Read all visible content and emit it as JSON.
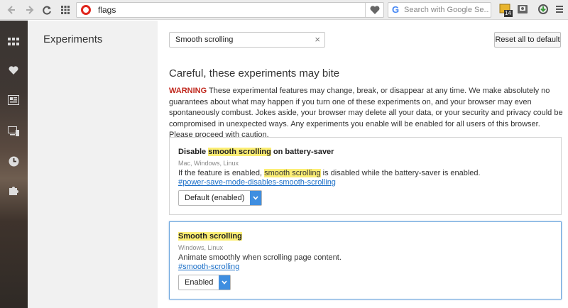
{
  "toolbar": {
    "url": "flags",
    "search_placeholder": "Search with Google Se...",
    "ext_badge": "14"
  },
  "leftnav": {
    "title": "Experiments"
  },
  "main": {
    "filter_value": "Smooth scrolling",
    "clear_glyph": "×",
    "reset_label": "Reset all to default",
    "heading": "Careful, these experiments may bite",
    "warning_label": "WARNING",
    "warning_text": " These experimental features may change, break, or disappear at any time. We make absolutely no guarantees about what may happen if you turn one of these experiments on, and your browser may even spontaneously combust. Jokes aside, your browser may delete all your data, or your security and privacy could be compromised in unexpected ways. Any experiments you enable will be enabled for all users of this browser. Please proceed with caution."
  },
  "experiments": [
    {
      "name_pre": "Disable ",
      "name_hl": "smooth scrolling",
      "name_post": " on battery-saver",
      "platforms": "Mac, Windows, Linux",
      "desc_pre": "If the feature is enabled, ",
      "desc_hl": "smooth scrolling",
      "desc_post": " is disabled while the battery-saver is enabled.",
      "link": "#power-save-mode-disables-smooth-scrolling",
      "select_value": "Default (enabled)"
    },
    {
      "name_hl": "Smooth scrolling",
      "platforms": "Windows, Linux",
      "desc": "Animate smoothly when scrolling page content.",
      "link": "#smooth-scrolling",
      "select_value": "Enabled"
    }
  ],
  "icons": {
    "back": "arrow-left-icon",
    "forward": "arrow-right-icon",
    "reload": "reload-icon",
    "tabs": "grid-icon",
    "opera": "opera-logo-icon",
    "bookmark": "heart-icon",
    "google": "google-icon",
    "sidebar": [
      "speed-dial-icon",
      "heart-icon",
      "news-icon",
      "devices-icon",
      "history-icon",
      "extensions-icon"
    ],
    "ext": [
      "extension-badge-icon",
      "camera-icon",
      "update-icon",
      "menu-icon"
    ]
  },
  "colors": {
    "accent": "#3f8ee0",
    "warning": "#c0271c",
    "highlight": "#fcee74",
    "link": "#1a6ec7"
  }
}
